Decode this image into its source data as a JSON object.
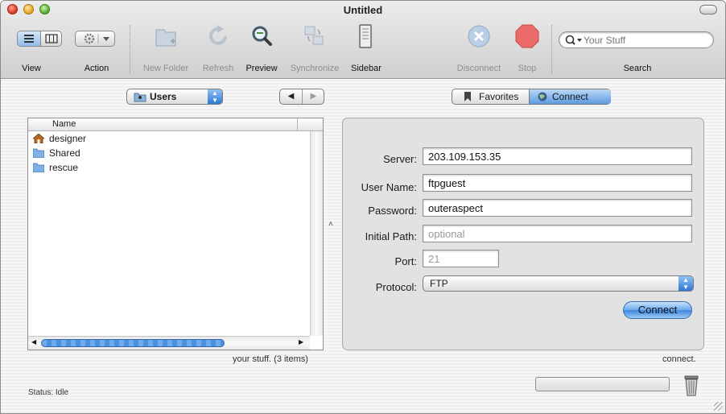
{
  "window": {
    "title": "Untitled"
  },
  "toolbar": {
    "view_label": "View",
    "action_label": "Action",
    "new_folder_label": "New Folder",
    "refresh_label": "Refresh",
    "preview_label": "Preview",
    "synchronize_label": "Synchronize",
    "sidebar_label": "Sidebar",
    "disconnect_label": "Disconnect",
    "stop_label": "Stop",
    "search_label": "Search",
    "search_placeholder": "Your Stuff"
  },
  "browser": {
    "location_popup": "Users",
    "column_header": "Name",
    "items": [
      {
        "name": "designer",
        "icon": "home-folder-icon"
      },
      {
        "name": "Shared",
        "icon": "folder-icon"
      },
      {
        "name": "rescue",
        "icon": "folder-icon"
      }
    ],
    "footer": "your stuff. (3 items)"
  },
  "mode_tabs": {
    "favorites": "Favorites",
    "connect": "Connect",
    "selected": "Connect"
  },
  "connect_form": {
    "server_label": "Server:",
    "server_value": "203.109.153.35",
    "username_label": "User Name:",
    "username_value": "ftpguest",
    "password_label": "Password:",
    "password_value": "outeraspect",
    "initial_path_label": "Initial Path:",
    "initial_path_placeholder": "optional",
    "port_label": "Port:",
    "port_placeholder": "21",
    "protocol_label": "Protocol:",
    "protocol_value": "FTP",
    "connect_button": "Connect",
    "footer": "connect."
  },
  "status": {
    "text": "Status: Idle"
  },
  "colors": {
    "accent": "#3e86dd",
    "stop": "#e23a3a",
    "close": "#d8331e",
    "minimize": "#e2a11a",
    "zoom": "#4fa72b"
  }
}
